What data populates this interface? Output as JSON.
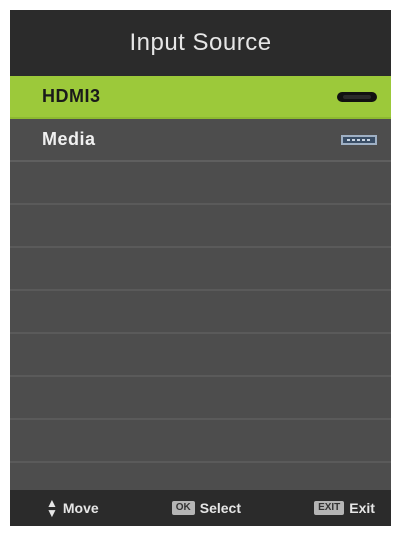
{
  "menu": {
    "title": "Input Source",
    "items": [
      {
        "label": "HDMI3",
        "icon": "hdmi-port-icon",
        "selected": true
      },
      {
        "label": "Media",
        "icon": "usb-port-icon",
        "selected": false
      }
    ],
    "empty_rows": 8
  },
  "footer": {
    "move_label": "Move",
    "select_key": "OK",
    "select_label": "Select",
    "exit_key": "EXIT",
    "exit_label": "Exit"
  },
  "colors": {
    "highlight": "#9cc93a",
    "panel": "#4d4d4d",
    "header": "#2b2b2b"
  }
}
